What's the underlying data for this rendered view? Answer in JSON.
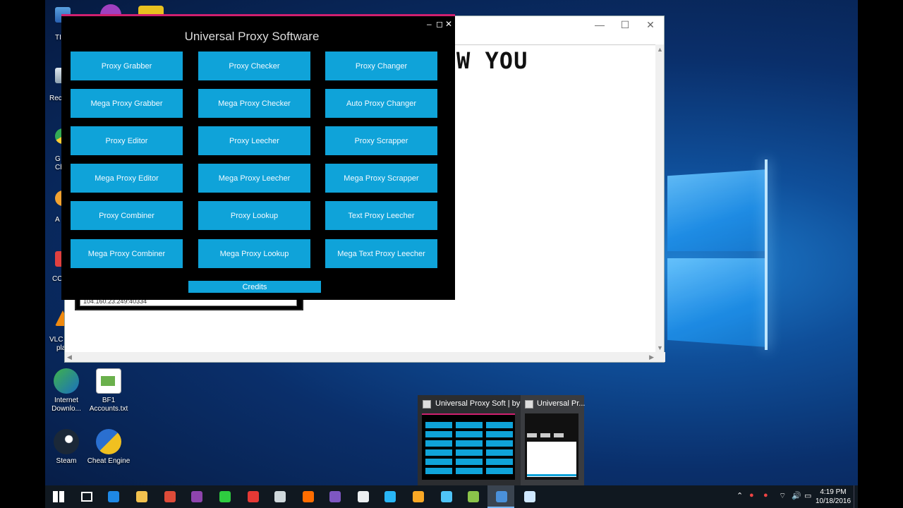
{
  "desktop": {
    "left_fragments": [
      "TI",
      "Rec",
      "G",
      "Ch",
      "A",
      "CC",
      "VLC",
      "pla"
    ],
    "icons": [
      {
        "label_line1": "Internet",
        "label_line2": "Downlo...",
        "icon": "idm-icon"
      },
      {
        "label_line1": "BF1",
        "label_line2": "Accounts.txt",
        "icon": "text-file-icon"
      },
      {
        "label_line1": "Steam",
        "label_line2": "",
        "icon": "steam-icon"
      },
      {
        "label_line1": "Cheat Engine",
        "label_line2": "",
        "icon": "cheat-engine-icon"
      }
    ]
  },
  "notepad": {
    "visible_text": "W YOU",
    "controls": {
      "minimize": "—",
      "maximize": "☐",
      "close": "✕"
    }
  },
  "small_window": {
    "field_value": "104.160.23.249:40334"
  },
  "proxy_app": {
    "title": "Universal Proxy Software",
    "controls": {
      "minimize": "–",
      "maximize": "◻",
      "close": "✕"
    },
    "buttons": [
      [
        "Proxy Grabber",
        "Proxy Checker",
        "Proxy Changer"
      ],
      [
        "Mega Proxy Grabber",
        "Mega Proxy Checker",
        "Auto Proxy Changer"
      ],
      [
        "Proxy Editor",
        "Proxy Leecher",
        "Proxy Scrapper"
      ],
      [
        "Mega Proxy Editor",
        "Mega Proxy Leecher",
        "Mega Proxy Scrapper"
      ],
      [
        "Proxy Combiner",
        "Proxy Lookup",
        "Text Proxy Leecher"
      ],
      [
        "Mega Proxy Combiner",
        "Mega Proxy Lookup",
        "Mega Text Proxy Leecher"
      ]
    ],
    "credits_label": "Credits",
    "accent_color": "#0fa3d9",
    "title_bar_color": "#d0206f"
  },
  "taskbar_preview": {
    "items": [
      {
        "title": "Universal Proxy Soft | by ..."
      },
      {
        "title": "Universal Pr..."
      }
    ]
  },
  "taskbar": {
    "clock_time": "4:19 PM",
    "clock_date": "10/18/2016",
    "pinned": [
      "start-icon",
      "task-view-icon",
      "edge-icon",
      "file-explorer-icon",
      "chrome-icon",
      "visual-studio-icon",
      "jd-icon",
      "app-red-icon",
      "app-plane-icon",
      "app-orange-icon",
      "app-dp-icon",
      "app-grey-icon",
      "app-blue-icon",
      "notepad-icon",
      "app-plane2-icon",
      "app-notepad-icon",
      "universal-proxy-icon",
      "app-paper-icon"
    ]
  }
}
